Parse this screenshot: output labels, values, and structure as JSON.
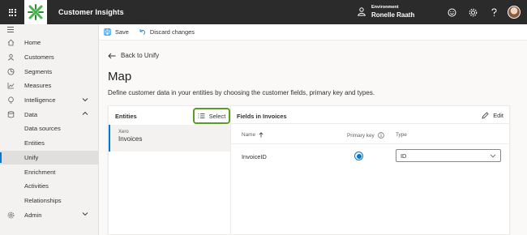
{
  "app": {
    "title": "Customer Insights"
  },
  "environment": {
    "label": "Environment",
    "name": "Ronelle Raath"
  },
  "topbar_icons": [
    "smiley-icon",
    "gear-icon",
    "help-icon"
  ],
  "nav": {
    "items": [
      {
        "label": "Home",
        "icon": "home-icon"
      },
      {
        "label": "Customers",
        "icon": "person-icon"
      },
      {
        "label": "Segments",
        "icon": "pie-icon"
      },
      {
        "label": "Measures",
        "icon": "chart-icon"
      },
      {
        "label": "Intelligence",
        "icon": "bulb-icon"
      },
      {
        "label": "Data",
        "icon": "database-icon"
      },
      {
        "label": "Data sources"
      },
      {
        "label": "Entities"
      },
      {
        "label": "Unify"
      },
      {
        "label": "Enrichment"
      },
      {
        "label": "Activities"
      },
      {
        "label": "Relationships"
      },
      {
        "label": "Admin",
        "icon": "admin-gear-icon"
      }
    ],
    "active": "Unify"
  },
  "toolbar": {
    "save_label": "Save",
    "discard_label": "Discard changes"
  },
  "back": {
    "label": "Back to Unify"
  },
  "page": {
    "title": "Map",
    "description": "Define customer data in your entities by choosing the customer fields, primary key and types."
  },
  "entities_panel": {
    "title": "Entities",
    "select_label": "Select",
    "items": [
      {
        "source": "Xero",
        "name": "Invoices"
      }
    ]
  },
  "fields_panel": {
    "title": "Fields in Invoices",
    "edit_label": "Edit",
    "columns": {
      "name": "Name",
      "primary_key": "Primary key",
      "type": "Type"
    },
    "rows": [
      {
        "name": "InvoiceID",
        "primary_key": true,
        "type": "ID"
      }
    ]
  },
  "colors": {
    "accent": "#0078d4",
    "select_highlight": "#5c9b2a",
    "topbar": "#2b2b2b"
  }
}
